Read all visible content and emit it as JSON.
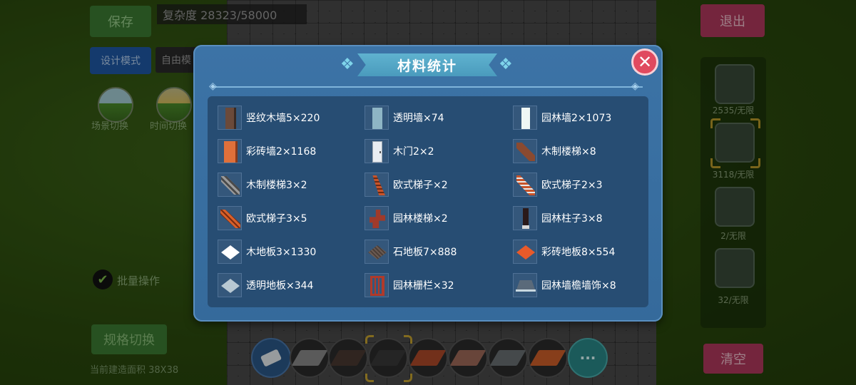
{
  "hud": {
    "save_label": "保存",
    "complexity_text": "复杂度 28323/58000",
    "exit_label": "退出",
    "design_mode_label": "设计模式",
    "free_mode_label": "自由模",
    "scene_switch_label": "场景切换",
    "time_switch_label": "时间切换",
    "batch_label": "批量操作",
    "spec_switch_label": "规格切换",
    "area_label": "当前建造面积 38X38",
    "clear_label": "清空",
    "right_counts": [
      "2535/无限",
      "3118/无限",
      "2/无限",
      "32/无限"
    ]
  },
  "modal": {
    "title": "材料统计",
    "close_icon": "close-icon",
    "items": [
      {
        "label": "竖纹木墙5×220",
        "icon": "vertical-wood-wall-icon",
        "color": "#7a4a2a"
      },
      {
        "label": "透明墙×74",
        "icon": "glass-wall-icon",
        "color": "#9fc6d2"
      },
      {
        "label": "园林墙2×1073",
        "icon": "garden-wall-icon",
        "color": "#e8f4f2"
      },
      {
        "label": "彩砖墙2×1168",
        "icon": "color-brick-wall-icon",
        "color": "#e0703a"
      },
      {
        "label": "木门2×2",
        "icon": "wooden-door-icon",
        "color": "#e9edf2"
      },
      {
        "label": "木制楼梯×8",
        "icon": "wooden-stairs-icon",
        "color": "#8a4a30"
      },
      {
        "label": "木制楼梯3×2",
        "icon": "wooden-stairs-icon",
        "color": "#9a9a9a"
      },
      {
        "label": "欧式梯子×2",
        "icon": "european-ladder-icon",
        "color": "#c8542a"
      },
      {
        "label": "欧式梯子2×3",
        "icon": "european-ladder-icon",
        "color": "#c8542a"
      },
      {
        "label": "欧式梯子3×5",
        "icon": "european-ladder-icon",
        "color": "#d8602a"
      },
      {
        "label": "园林楼梯×2",
        "icon": "garden-stairs-icon",
        "color": "#a03a2a"
      },
      {
        "label": "园林柱子3×8",
        "icon": "garden-pillar-icon",
        "color": "#2a1a1a"
      },
      {
        "label": "木地板3×1330",
        "icon": "wood-floor-icon",
        "color": "#ffffff"
      },
      {
        "label": "石地板7×888",
        "icon": "stone-floor-icon",
        "color": "#6a5a52"
      },
      {
        "label": "彩砖地板8×554",
        "icon": "color-brick-floor-icon",
        "color": "#e85a2a"
      },
      {
        "label": "透明地板×344",
        "icon": "glass-floor-icon",
        "color": "#b8c8d2"
      },
      {
        "label": "园林栅栏×32",
        "icon": "garden-fence-icon",
        "color": "#b03a2a"
      },
      {
        "label": "园林墙檐墙饰×8",
        "icon": "garden-eave-decoration-icon",
        "color": "#5a6a7a"
      }
    ]
  },
  "hotbar": {
    "slots": [
      "eraser-icon",
      "light-floor-icon",
      "dark-wood-floor-icon",
      "dark-floor-icon",
      "brick-floor-icon",
      "pattern-floor-icon",
      "gray-floor-icon",
      "orange-floor-icon"
    ],
    "more_label": "···"
  }
}
